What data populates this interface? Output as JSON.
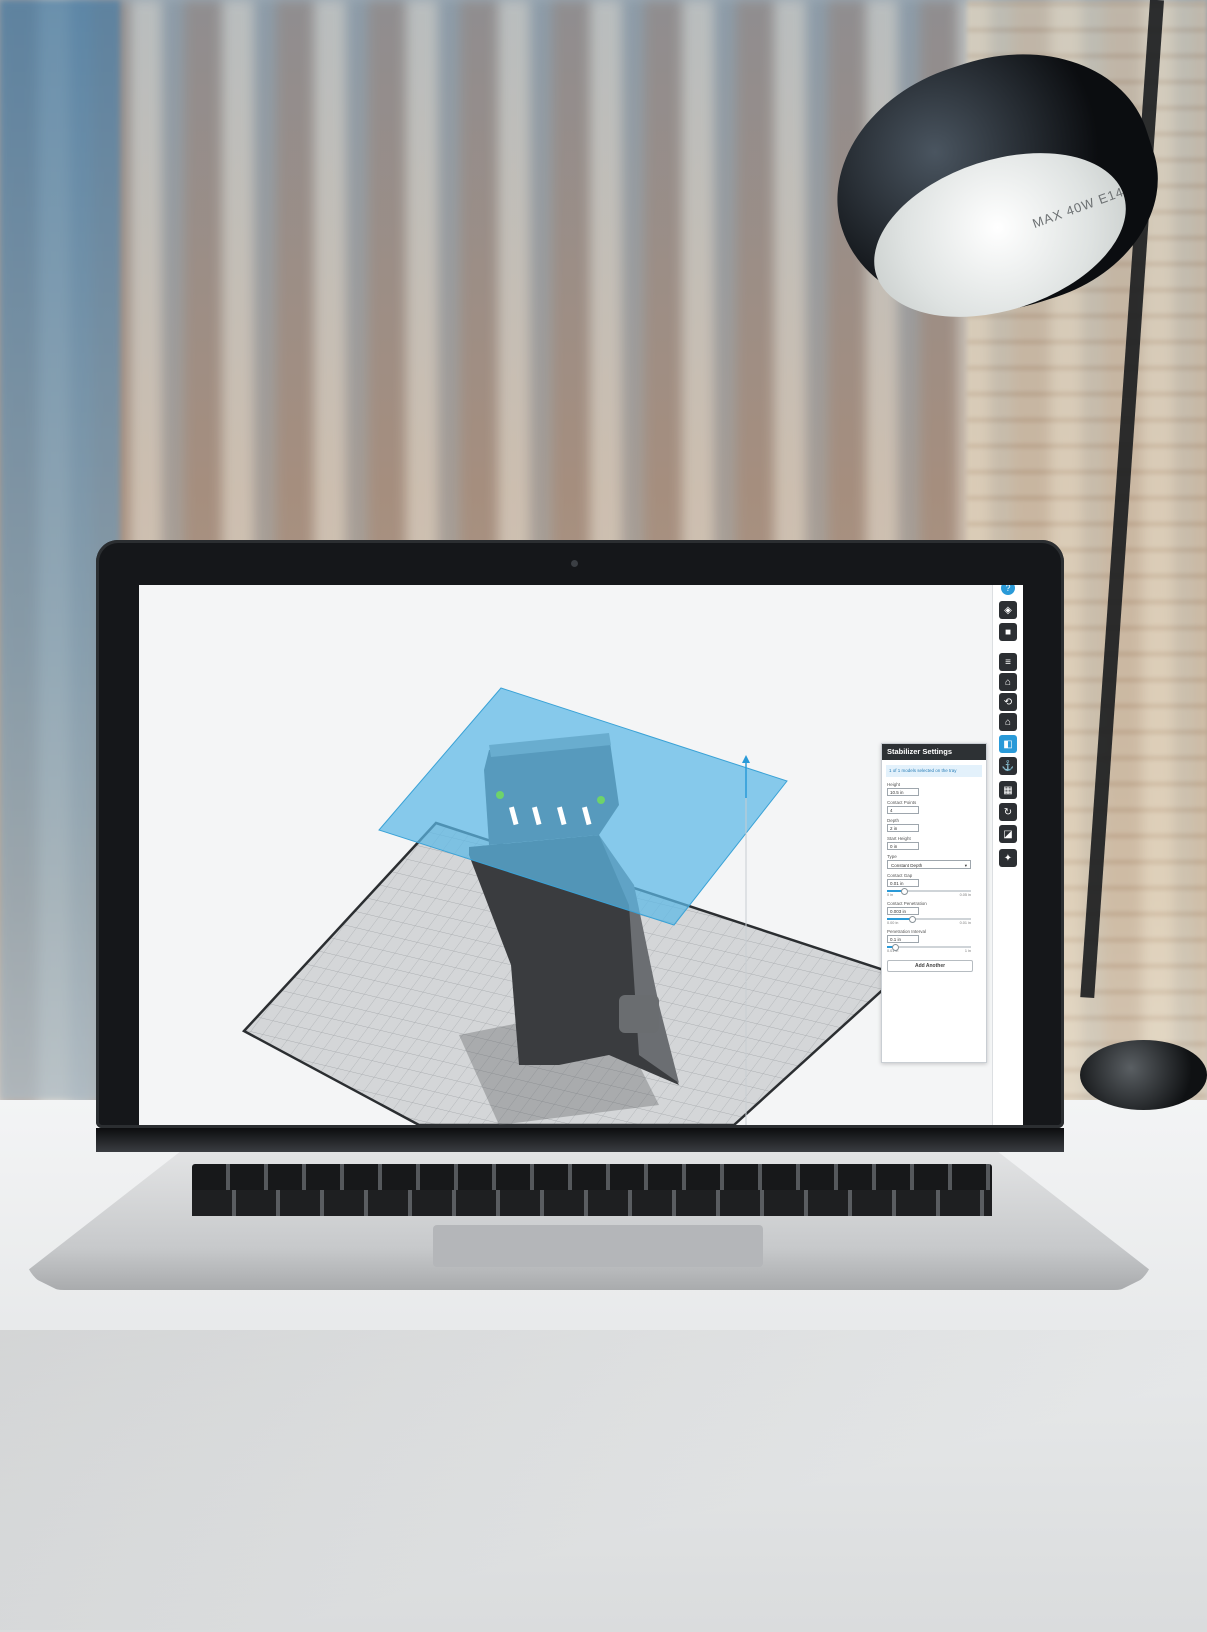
{
  "scene": {
    "lamp_label": "MAX 40W E14"
  },
  "toolbar": {
    "help_glyph": "?",
    "tools": [
      {
        "icon": "view-cube-icon"
      },
      {
        "icon": "shaded-cube-icon"
      },
      {
        "icon": "layers-icon"
      },
      {
        "icon": "support-icon"
      },
      {
        "icon": "orientation-icon"
      },
      {
        "icon": "home-icon"
      },
      {
        "icon": "stabilizer-icon",
        "active": true
      },
      {
        "icon": "anchor-icon"
      },
      {
        "icon": "arrange-icon"
      },
      {
        "icon": "rotate-icon"
      },
      {
        "icon": "scale-icon"
      },
      {
        "icon": "repair-icon"
      }
    ]
  },
  "panel": {
    "title": "Stabilizer Settings",
    "notice": "1 of 1 models selected on the tray",
    "fields": {
      "height": {
        "label": "Height",
        "value": "10.5 in"
      },
      "contact_points": {
        "label": "Contact Points",
        "value": "4"
      },
      "depth": {
        "label": "Depth",
        "value": "2 in"
      },
      "start_height": {
        "label": "Start Height",
        "value": "0 in"
      },
      "type": {
        "label": "Type",
        "value": "Constant Depth"
      },
      "contact_gap": {
        "label": "Contact Gap",
        "value": "0.01 in",
        "min": "0 in",
        "max": "0.05 in",
        "level": 0.2
      },
      "contact_penetration": {
        "label": "Contact Penetration",
        "value": "0.003 in",
        "min": "0.00 in",
        "max": "0.01 in",
        "level": 0.3
      },
      "penetration_interval": {
        "label": "Penetration Interval",
        "value": "0.1 in",
        "min": "0.01 in",
        "max": "1 in",
        "level": 0.1
      }
    },
    "add_button": "Add Another"
  },
  "colors": {
    "accent": "#2a9ad8",
    "plane": "#5bb8e6",
    "model": "#3a3c3f",
    "grid": "#c9cbcd"
  }
}
